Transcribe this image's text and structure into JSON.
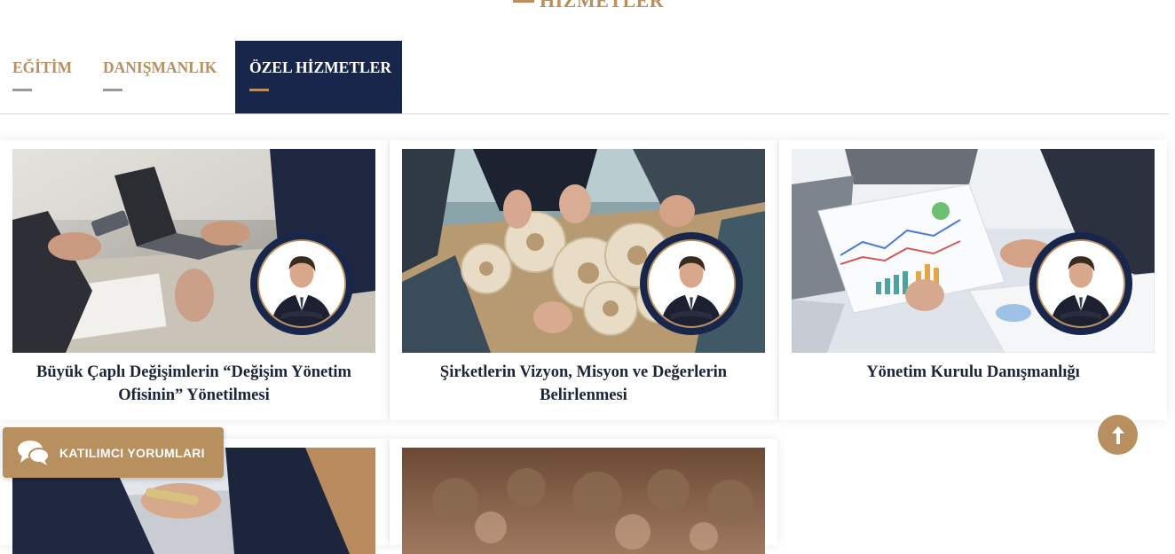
{
  "section": {
    "title": "HİZMETLER"
  },
  "tabs": [
    {
      "label": "EĞİTİM",
      "active": false
    },
    {
      "label": "DANIŞMANLIK",
      "active": false
    },
    {
      "label": "ÖZEL HİZMETLER",
      "active": true
    }
  ],
  "cards": [
    {
      "title": "Büyük Çaplı Değişimlerin “Değişim Yönetim Ofisinin” Yönetilmesi",
      "image": "meeting-laptop-photo"
    },
    {
      "title": "Şirketlerin Vizyon, Misyon ve Değerlerin Belirlenmesi",
      "image": "team-gears-photo"
    },
    {
      "title": "Yönetim Kurulu Danışmanlığı",
      "image": "chart-report-photo"
    },
    {
      "title": "",
      "image": "handshake-photo"
    },
    {
      "title": "",
      "image": "conference-blur-photo"
    }
  ],
  "floating": {
    "reviews_label": "KATILIMCI YORUMLARI",
    "reviews_icon": "chat-bubbles-icon",
    "scroll_icon": "arrow-up-icon"
  },
  "colors": {
    "accent": "#b8905f",
    "navy": "#17264a",
    "text": "#1c2437"
  }
}
